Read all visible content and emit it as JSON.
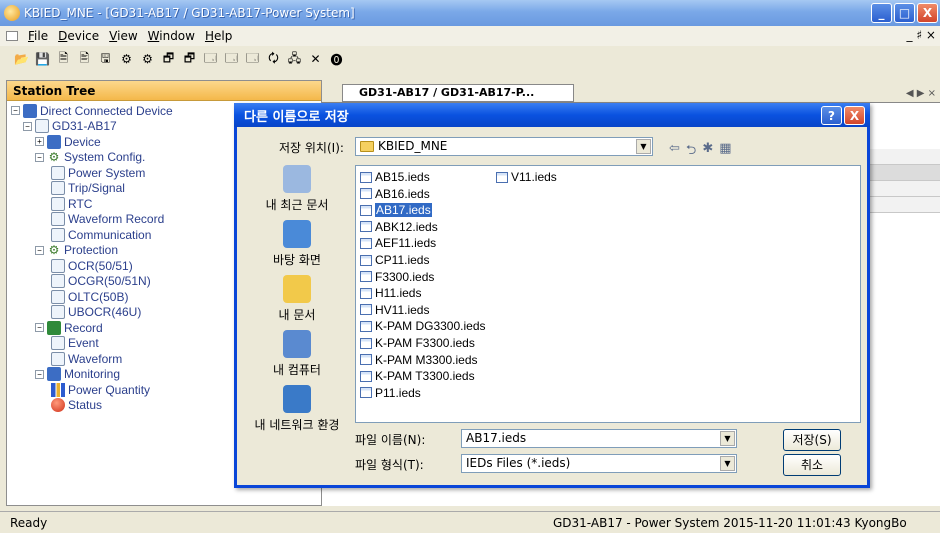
{
  "window": {
    "title": "KBIED_MNE - [GD31-AB17 / GD31-AB17-Power System]",
    "min": "_",
    "max": "□",
    "close": "X",
    "mdi_controls": "_ ♯ ×"
  },
  "menu": [
    "File",
    "Device",
    "View",
    "Window",
    "Help"
  ],
  "toolbar": [
    "📂",
    "💾",
    "🗎",
    "🖹",
    "🖫",
    "⚙",
    "⚙",
    "🗗",
    "🗗",
    "🗔",
    "🗔",
    "🗔",
    "🗘",
    "🖧",
    "✕",
    "⓿"
  ],
  "tree": {
    "header": "Station Tree",
    "nodes": [
      {
        "label": "Direct Connected Device",
        "exp": "−",
        "icon": "mon"
      },
      {
        "label": "GD31-AB17",
        "exp": "−",
        "icon": "doc"
      },
      {
        "label": "Device",
        "exp": "+",
        "icon": "folder"
      },
      {
        "label": "System Config.",
        "exp": "−",
        "icon": "gear"
      },
      {
        "label": "Power System",
        "exp": "",
        "icon": "doc"
      },
      {
        "label": "Trip/Signal",
        "exp": "",
        "icon": "doc"
      },
      {
        "label": "RTC",
        "exp": "",
        "icon": "doc"
      },
      {
        "label": "Waveform Record",
        "exp": "",
        "icon": "doc"
      },
      {
        "label": "Communication",
        "exp": "",
        "icon": "doc"
      },
      {
        "label": "Protection",
        "exp": "−",
        "icon": "gear"
      },
      {
        "label": "OCR(50/51)",
        "exp": "",
        "icon": "doc"
      },
      {
        "label": "OCGR(50/51N)",
        "exp": "",
        "icon": "doc"
      },
      {
        "label": "OLTC(50B)",
        "exp": "",
        "icon": "doc"
      },
      {
        "label": "UBOCR(46U)",
        "exp": "",
        "icon": "doc"
      },
      {
        "label": "Record",
        "exp": "−",
        "icon": "rec"
      },
      {
        "label": "Event",
        "exp": "",
        "icon": "doc"
      },
      {
        "label": "Waveform",
        "exp": "",
        "icon": "doc"
      },
      {
        "label": "Monitoring",
        "exp": "−",
        "icon": "mon"
      },
      {
        "label": "Power Quantity",
        "exp": "",
        "icon": "bar"
      },
      {
        "label": "Status",
        "exp": "",
        "icon": "ball"
      }
    ]
  },
  "doc_tab": {
    "title": "GD31-AB17 / GD31-AB17-P...",
    "arrows": "◀ ▶ ×"
  },
  "status": {
    "ready": "Ready",
    "info": "GD31-AB17 - Power System  2015-11-20 11:01:43  KyongBo"
  },
  "dialog": {
    "title": "다른 이름으로 저장",
    "help": "?",
    "close": "X",
    "location_label": "저장 위치(I):",
    "location_value": "KBIED_MNE",
    "nav_icons": [
      "⇦",
      "⮌",
      "✱",
      "▦"
    ],
    "places": [
      "내 최근 문서",
      "바탕 화면",
      "내 문서",
      "내 컴퓨터",
      "내 네트워크 환경"
    ],
    "files_col1": [
      "AB15.ieds",
      "AB16.ieds",
      "AB17.ieds",
      "ABK12.ieds",
      "AEF11.ieds",
      "CP11.ieds",
      "F3300.ieds",
      "H11.ieds",
      "HV11.ieds",
      "K-PAM DG3300.ieds",
      "K-PAM F3300.ieds",
      "K-PAM M3300.ieds",
      "K-PAM T3300.ieds",
      "P11.ieds"
    ],
    "files_col2": [
      "V11.ieds"
    ],
    "selected_file": "AB17.ieds",
    "filename_label": "파일 이름(N):",
    "filename_value": "AB17.ieds",
    "filetype_label": "파일 형식(T):",
    "filetype_value": "IEDs Files (*.ieds)",
    "save_button": "저장(S)",
    "cancel_button": "취소"
  }
}
